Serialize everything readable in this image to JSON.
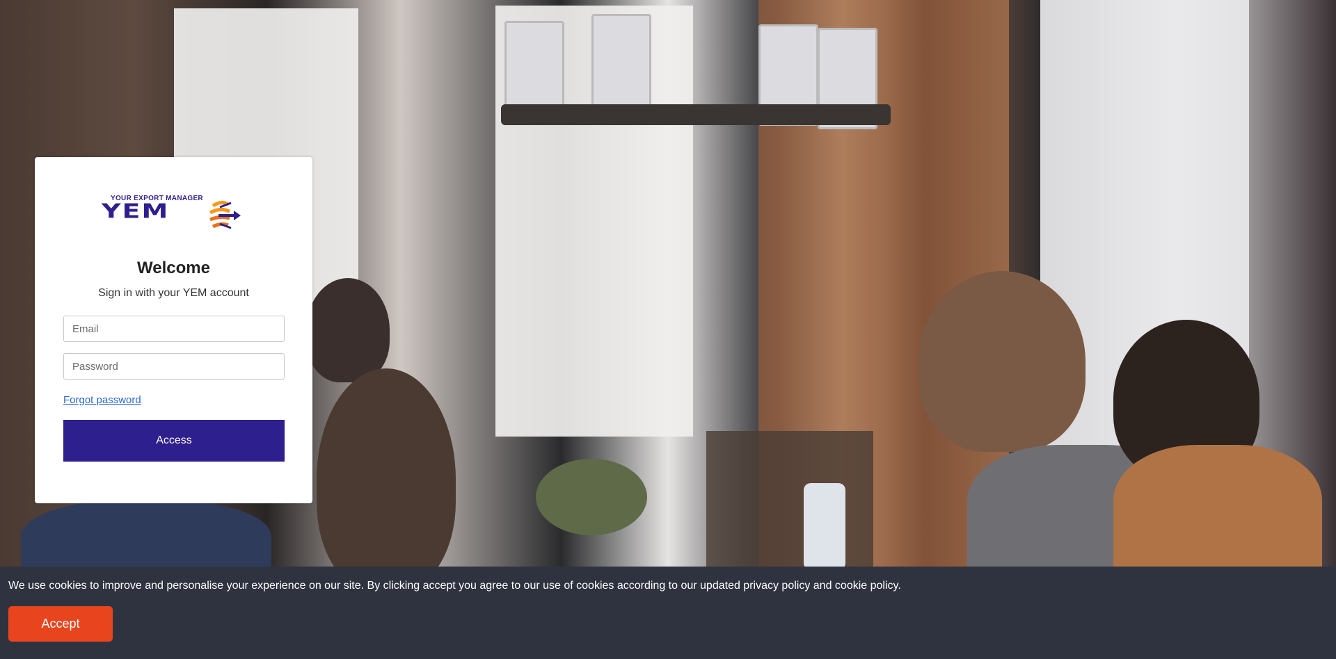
{
  "background": {
    "description_icon": "office-photo"
  },
  "login": {
    "logo": {
      "tagline": "YOUR EXPORT MANAGER",
      "wordmark": "YEM",
      "icon": "yem-globe-arrow-icon",
      "colors": {
        "primary": "#2e1f8e",
        "accent": "#f39a1e"
      }
    },
    "title": "Welcome",
    "subtitle": "Sign in with your YEM account",
    "email_placeholder": "Email",
    "email_value": "",
    "password_placeholder": "Password",
    "password_value": "",
    "forgot_password": "Forgot password",
    "submit_label": "Access",
    "button_color": "#2e1f8e"
  },
  "cookie_banner": {
    "message": "We use cookies to improve and personalise your experience on our site. By clicking accept you agree to our use of cookies according to our updated privacy policy and cookie policy.",
    "accept_label": "Accept",
    "background_color": "#2f3340",
    "accept_color": "#e8451e"
  }
}
